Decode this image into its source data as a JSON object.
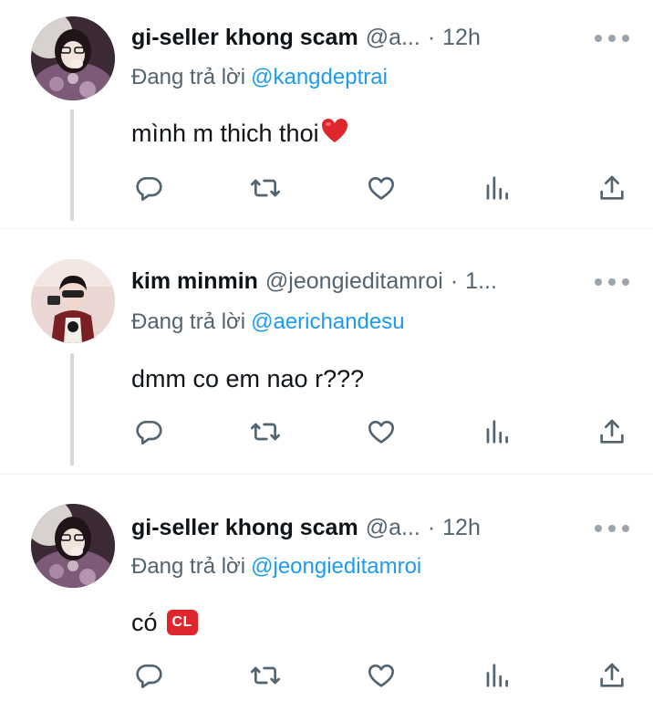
{
  "tweets": [
    {
      "display_name": "gi-seller khong scam",
      "handle": "@a...",
      "separator": "·",
      "time": "12h",
      "reply_prefix": "Đang trả lời",
      "reply_to": "@kangdeptrai",
      "text": "mình m thich thoi",
      "emoji": "heart-emoji"
    },
    {
      "display_name": "kim minmin",
      "handle": "@jeongieditamroi",
      "separator": "·",
      "time": "1...",
      "reply_prefix": "Đang trả lời",
      "reply_to": "@aerichandesu",
      "text": "dmm co em nao r???"
    },
    {
      "display_name": "gi-seller khong scam",
      "handle": "@a...",
      "separator": "·",
      "time": "12h",
      "reply_prefix": "Đang trả lời",
      "reply_to": "@jeongieditamroi",
      "text": "có",
      "emoji_label": "CL"
    }
  ],
  "action_icons": [
    "reply-icon",
    "retweet-icon",
    "like-icon",
    "views-icon",
    "share-icon"
  ],
  "colors": {
    "text": "#0f1419",
    "secondary": "#536471",
    "link": "#1d9bf0",
    "thread_line": "#cfd9de",
    "divider": "#eff3f4",
    "icon": "#536471"
  }
}
